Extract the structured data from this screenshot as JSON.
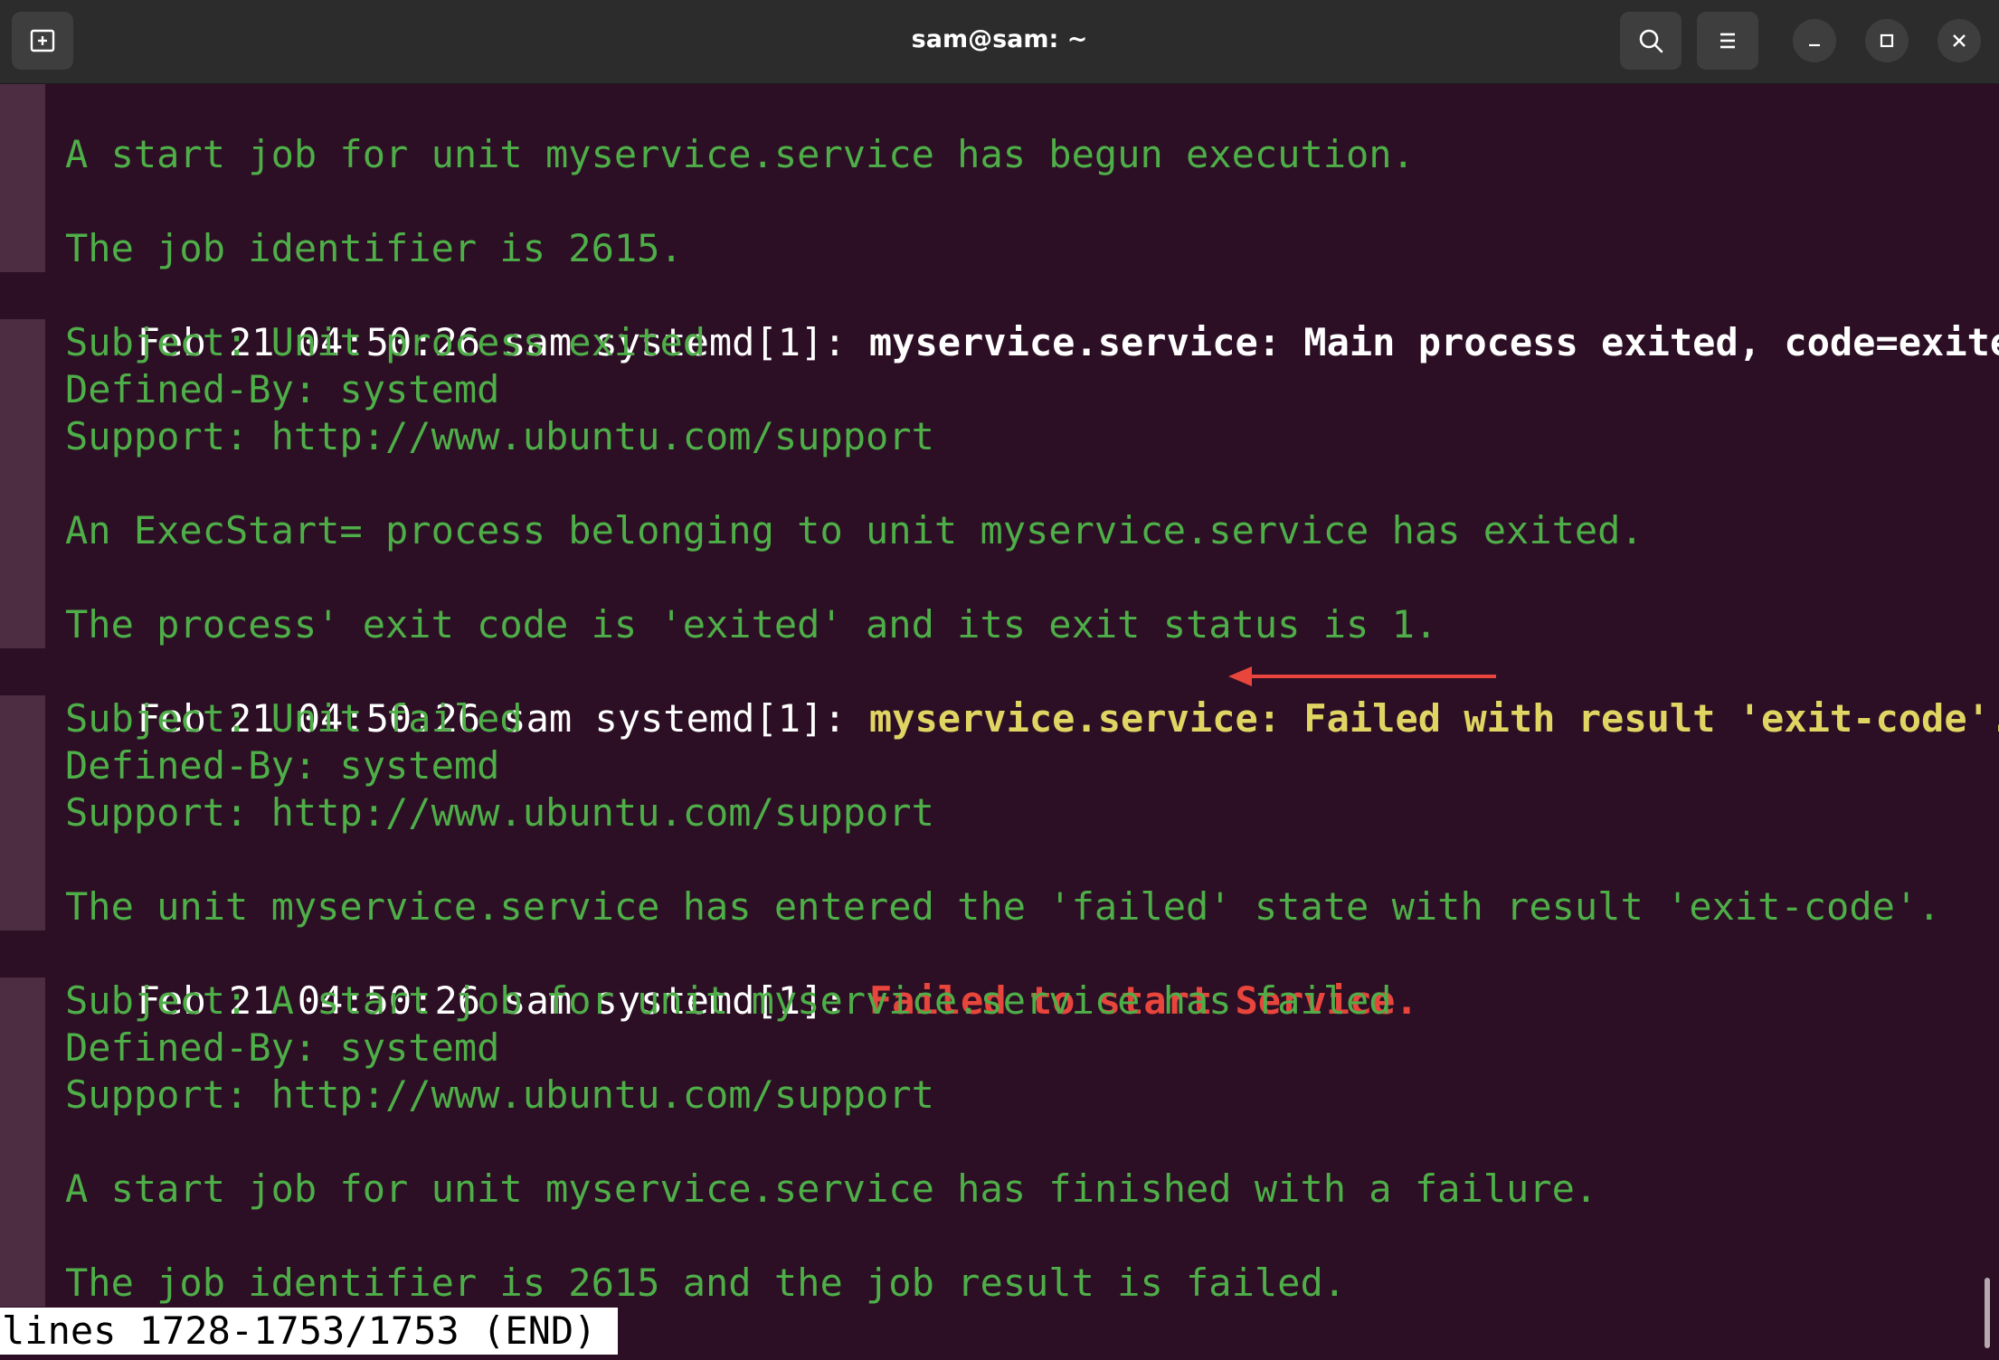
{
  "window": {
    "title": "sam@sam: ~",
    "icons": {
      "new_tab": "new-tab-icon",
      "search": "search-icon",
      "menu": "hamburger-menu-icon",
      "minimize": "minimize-icon",
      "maximize": "maximize-icon",
      "close": "close-icon"
    }
  },
  "colors": {
    "terminal_background": "#2c0f24",
    "titlebar_background": "#2c2c2c",
    "subtext_green": "#4eae48",
    "highlight_yellow": "#e0d562",
    "error_red": "#e8453c",
    "annotation_arrow": "#e8453c"
  },
  "terminal": {
    "lines": [
      {
        "text": "A start job for unit myservice.service has begun execution."
      },
      {
        "text": "The job identifier is 2615."
      },
      {
        "prefix": "Feb 21 04:50:26 sam systemd[1]: ",
        "message": "myservice.service: Main process exited, code=exited, statu",
        "overflow": ">"
      },
      {
        "text": "Subject: Unit process exited"
      },
      {
        "text": "Defined-By: systemd"
      },
      {
        "text": "Support: http://www.ubuntu.com/support"
      },
      {
        "text": "An ExecStart= process belonging to unit myservice.service has exited."
      },
      {
        "text": "The process' exit code is 'exited' and its exit status is 1."
      },
      {
        "prefix": "Feb 21 04:50:26 sam systemd[1]: ",
        "message": "myservice.service: Failed with result 'exit-code'."
      },
      {
        "text": "Subject: Unit failed"
      },
      {
        "text": "Defined-By: systemd"
      },
      {
        "text": "Support: http://www.ubuntu.com/support"
      },
      {
        "text": "The unit myservice.service has entered the 'failed' state with result 'exit-code'."
      },
      {
        "prefix": "Feb 21 04:50:26 sam systemd[1]: ",
        "message": "Failed to start Service."
      },
      {
        "text": "Subject: A start job for unit myservice.service has failed"
      },
      {
        "text": "Defined-By: systemd"
      },
      {
        "text": "Support: http://www.ubuntu.com/support"
      },
      {
        "text": "A start job for unit myservice.service has finished with a failure."
      },
      {
        "text": "The job identifier is 2615 and the job result is failed."
      }
    ],
    "status": "lines 1728-1753/1753 (END)"
  }
}
